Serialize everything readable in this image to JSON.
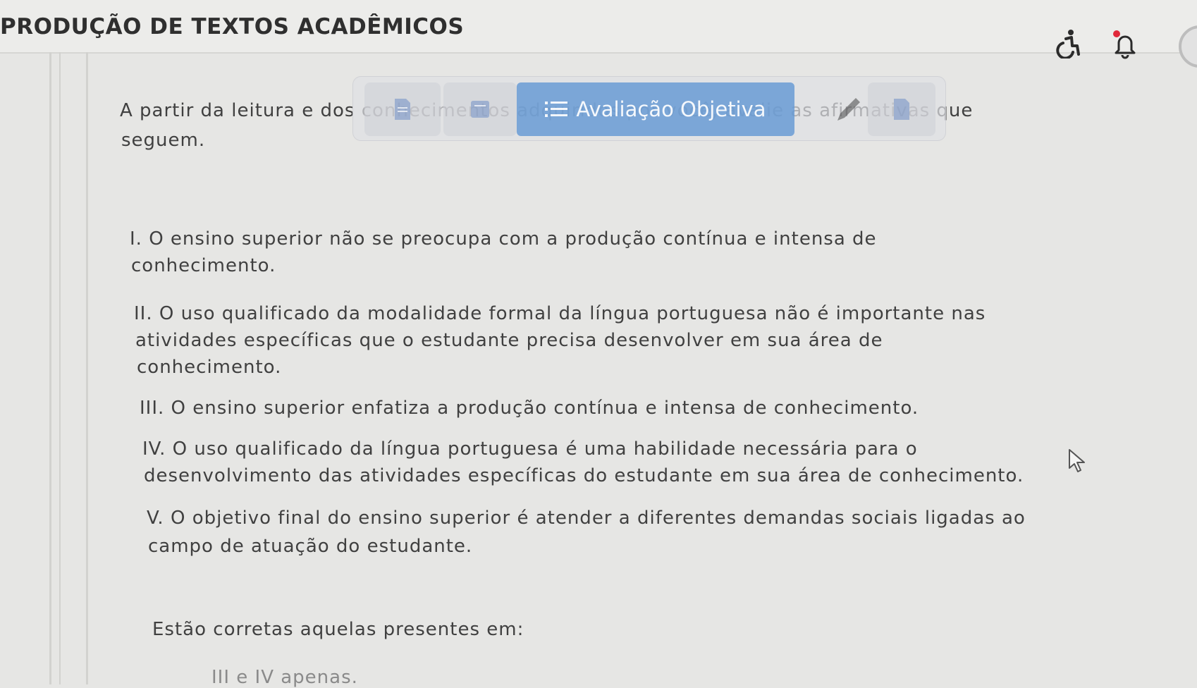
{
  "header": {
    "course_title": "PRODUÇÃO DE TEXTOS ACADÊMICOS"
  },
  "toolbar": {
    "active_tab_label": "Avaliação Objetiva"
  },
  "question": {
    "intro_line1": "A partir da leitura e dos conhecimentos adquiridos por você, avalie as afirmativas que",
    "intro_line2": "seguem.",
    "s1_line1": "I. O ensino superior não se preocupa com a produção contínua e intensa de",
    "s1_line2": "conhecimento.",
    "s2_line1": "II. O uso qualificado da modalidade formal da língua portuguesa não é importante nas",
    "s2_line2": "atividades específicas que o estudante precisa desenvolver em sua área de",
    "s2_line3": "conhecimento.",
    "s3_line1": "III. O ensino superior enfatiza a produção contínua e intensa de conhecimento.",
    "s4_line1": "IV. O uso qualificado da língua portuguesa é uma habilidade necessária para o",
    "s4_line2": "desenvolvimento das atividades específicas do estudante em sua área de conhecimento.",
    "s5_line1": "V. O objetivo final do ensino superior é atender a diferentes demandas sociais ligadas ao",
    "s5_line2": "campo de atuação do estudante.",
    "prompt": "Estão corretas aquelas presentes em:",
    "option_a": "III e IV apenas."
  },
  "icons": {
    "accessibility": "wheelchair-icon",
    "notifications": "bell-icon",
    "notification_dot_color": "#e0283a",
    "active_tab_color": "#6498d4"
  }
}
